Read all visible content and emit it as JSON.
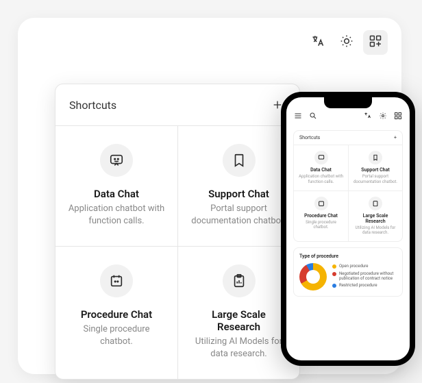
{
  "toolbar": {
    "translate_icon": "translate-icon",
    "theme_icon": "sun-icon",
    "apps_icon": "apps-grid-icon"
  },
  "shortcuts": {
    "title": "Shortcuts",
    "add_label": "+",
    "tiles": [
      {
        "icon": "chat-smile-icon",
        "title": "Data Chat",
        "desc": "Application chatbot with function calls."
      },
      {
        "icon": "bookmark-icon",
        "title": "Support Chat",
        "desc": "Portal support documentation chatbot."
      },
      {
        "icon": "calendar-chat-icon",
        "title": "Procedure Chat",
        "desc": "Single procedure chatbot."
      },
      {
        "icon": "clipboard-chart-icon",
        "title": "Large Scale Research",
        "desc": "Utilizing AI Models for data research."
      }
    ]
  },
  "phone": {
    "menu_icon": "menu-icon",
    "search_icon": "search-icon",
    "chart": {
      "title": "Type of procedure",
      "legend": [
        {
          "color": "#f5b301",
          "label": "Open procedure"
        },
        {
          "color": "#d63c2e",
          "label": "Negotiated procedure without publication of contract notice"
        },
        {
          "color": "#2a7de1",
          "label": "Restricted procedure"
        }
      ]
    }
  },
  "chart_data": {
    "type": "pie",
    "title": "Type of procedure",
    "series": [
      {
        "name": "Open procedure",
        "value": 67,
        "color": "#f5b301"
      },
      {
        "name": "Negotiated procedure without publication of contract notice",
        "value": 25,
        "color": "#d63c2e"
      },
      {
        "name": "Restricted procedure",
        "value": 8,
        "color": "#2a7de1"
      }
    ]
  }
}
